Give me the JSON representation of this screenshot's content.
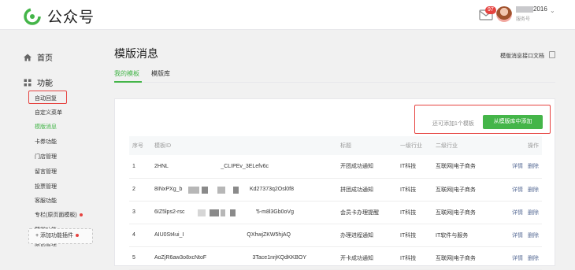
{
  "app": {
    "title": "公众号",
    "brand_color": "#44b549",
    "logo_icon": "wechat-official-accounts-logo"
  },
  "header": {
    "message_badge": "97",
    "account_name": "2016",
    "account_type": "服务号"
  },
  "sidebar": {
    "home": "首页",
    "features": "功能",
    "items": [
      {
        "label": "自动回复"
      },
      {
        "label": "自定义菜单"
      },
      {
        "label": "模版消息",
        "active": true
      },
      {
        "label": "卡券功能"
      },
      {
        "label": "门店管理"
      },
      {
        "label": "留言管理"
      },
      {
        "label": "投票管理"
      },
      {
        "label": "客服功能"
      },
      {
        "label": "专栏(原页面模板)",
        "dot": true
      },
      {
        "label": "赞赏功能"
      },
      {
        "label": "原创管理"
      }
    ],
    "add_plugin": "+ 添加功能插件"
  },
  "main": {
    "title": "模版消息",
    "doc_link": "模版消息接口文档",
    "tabs": [
      {
        "label": "我的模板",
        "active": true
      },
      {
        "label": "模版库"
      }
    ],
    "quota_text": "还可添加1个模板",
    "add_button": "从模版库中添加",
    "table": {
      "headers": [
        "序号",
        "模板ID",
        "标题",
        "一级行业",
        "二级行业",
        "操作"
      ],
      "rows": [
        {
          "no": "1",
          "id_start": "2HNL",
          "id_end": "_CLIPEv_3ELefv6c",
          "title": "开团成功通知",
          "ind1": "IT科技",
          "ind2": "互联网|电子商务"
        },
        {
          "no": "2",
          "id_start": "8INxPXg_b",
          "id_end": "Kd27373q2Osl0f8",
          "title": "拼团成功通知",
          "ind1": "IT科技",
          "ind2": "互联网|电子商务"
        },
        {
          "no": "3",
          "id_start": "6IZ5lps2-rsc",
          "id_end": "'5-m8l3Gb0oVg",
          "title": "会员卡办理提醒",
          "ind1": "IT科技",
          "ind2": "互联网|电子商务"
        },
        {
          "no": "4",
          "id_start": "AIU0St4ui_I",
          "id_end": "QXhwjZKW5hjAQ",
          "title": "办理进程通知",
          "ind1": "IT科技",
          "ind2": "IT软件与服务"
        },
        {
          "no": "5",
          "id_start": "AoZjR6aw3o8xcNtoF",
          "id_end": "3Tace1nrjKQdKKBOY",
          "title": "开卡成功通知",
          "ind1": "IT科技",
          "ind2": "互联网|电子商务"
        }
      ],
      "op_detail": "详情",
      "op_delete": "删除"
    }
  }
}
